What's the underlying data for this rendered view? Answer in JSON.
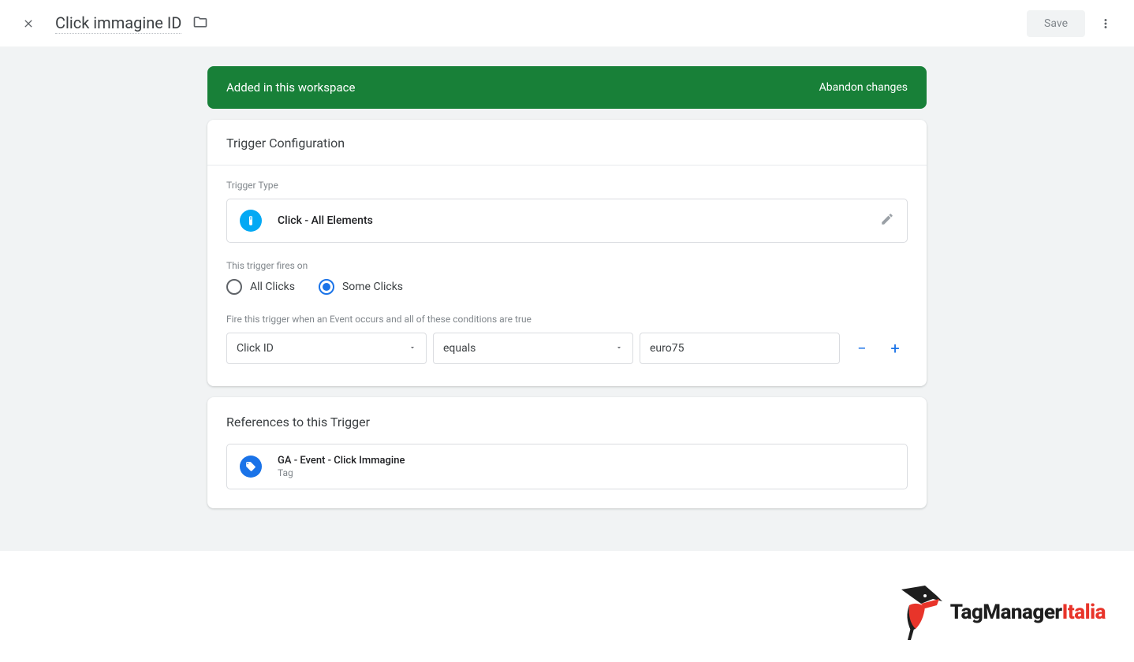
{
  "header": {
    "title": "Click immagine ID",
    "save_label": "Save"
  },
  "banner": {
    "message": "Added in this workspace",
    "action": "Abandon changes"
  },
  "config": {
    "card_title": "Trigger Configuration",
    "type_label": "Trigger Type",
    "type_value": "Click - All Elements",
    "fires_on_label": "This trigger fires on",
    "radio_all": "All Clicks",
    "radio_some": "Some Clicks",
    "conditions_label": "Fire this trigger when an Event occurs and all of these conditions are true",
    "cond_var": "Click ID",
    "cond_op": "equals",
    "cond_val": "euro75"
  },
  "references": {
    "card_title": "References to this Trigger",
    "item_name": "GA - Event - Click Immagine",
    "item_type": "Tag"
  },
  "logo": {
    "part1": "TagManager",
    "part2": "Italia"
  }
}
